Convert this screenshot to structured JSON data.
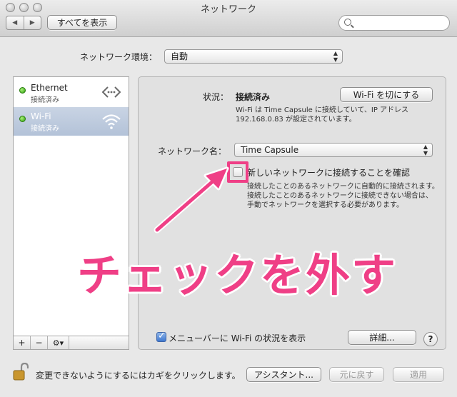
{
  "window": {
    "title": "ネットワーク"
  },
  "toolbar": {
    "show_all_label": "すべてを表示",
    "search_placeholder": "",
    "back_icon": "◀",
    "forward_icon": "▶"
  },
  "location": {
    "label": "ネットワーク環境：",
    "value": "自動"
  },
  "services": [
    {
      "name": "Ethernet",
      "status": "接続済み",
      "icon": "ethernet-icon"
    },
    {
      "name": "Wi-Fi",
      "status": "接続済み",
      "icon": "wifi-icon",
      "selected": true
    }
  ],
  "sidebar_controls": {
    "add": "+",
    "remove": "−",
    "gear": "⚙▾"
  },
  "detail": {
    "status_label": "状況：",
    "status_value": "接続済み",
    "wifi_off_button": "Wi-Fi を切にする",
    "status_desc_line1": "Wi-Fi は Time Capsule に接続していて、IP アドレス",
    "status_desc_line2": "192.168.0.83 が設定されています。",
    "network_name_label": "ネットワーク名：",
    "network_name_value": "Time Capsule",
    "ask_join_label": "新しいネットワークに接続することを確認",
    "ask_join_desc_line1": "接続したことのあるネットワークに自動的に接続されます。",
    "ask_join_desc_line2": "接続したことのあるネットワークに接続できない場合は、",
    "ask_join_desc_line3": "手動でネットワークを選択する必要があります。",
    "menubar_label": "メニューバーに Wi-Fi の状況を表示",
    "advanced_button": "詳細...",
    "help_label": "?"
  },
  "annotation": {
    "text": "チェックを外す",
    "color": "#ef3f86"
  },
  "footer": {
    "lock_text": "変更できないようにするにはカギをクリックします。",
    "assistant_button": "アシスタント...",
    "revert_button": "元に戻す",
    "apply_button": "適用"
  }
}
